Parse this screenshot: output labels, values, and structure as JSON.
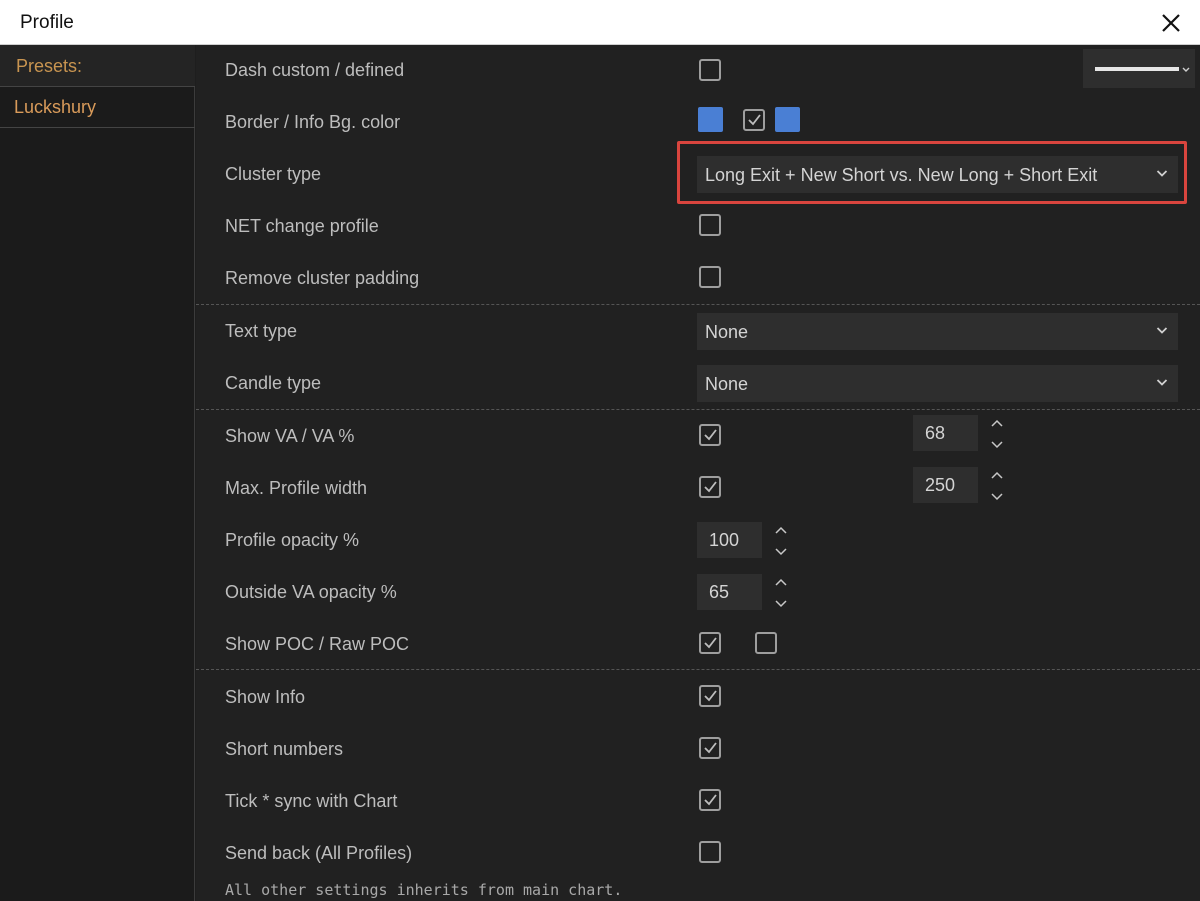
{
  "window": {
    "title": "Profile"
  },
  "sidebar": {
    "presets_label": "Presets:",
    "items": [
      {
        "label": "Luckshury"
      }
    ]
  },
  "settings": {
    "dash_custom": {
      "label": "Dash custom / defined",
      "checked": false
    },
    "border_info_bg": {
      "label": "Border / Info Bg. color",
      "border_color": "#4a7fd4",
      "info_bg_enabled": true,
      "info_bg_color": "#4a7fd4"
    },
    "cluster_type": {
      "label": "Cluster type",
      "value": "Long Exit + New Short vs. New Long + Short Exit"
    },
    "net_change": {
      "label": "NET change profile",
      "checked": false
    },
    "remove_padding": {
      "label": "Remove cluster padding",
      "checked": false
    },
    "text_type": {
      "label": "Text type",
      "value": "None"
    },
    "candle_type": {
      "label": "Candle type",
      "value": "None"
    },
    "show_va": {
      "label": "Show VA / VA %",
      "checked": true,
      "value": "68"
    },
    "max_width": {
      "label": "Max. Profile width",
      "checked": true,
      "value": "250"
    },
    "profile_opacity": {
      "label": "Profile opacity %",
      "value": "100"
    },
    "outside_va_opacity": {
      "label": "Outside VA opacity %",
      "value": "65"
    },
    "show_poc": {
      "label": "Show POC / Raw POC",
      "poc_checked": true,
      "raw_poc_checked": false
    },
    "show_info": {
      "label": "Show Info",
      "checked": true
    },
    "short_numbers": {
      "label": "Short numbers",
      "checked": true
    },
    "tick_sync": {
      "label": "Tick * sync with Chart",
      "checked": true
    },
    "send_back": {
      "label": "Send back (All Profiles)",
      "checked": false
    }
  },
  "footer": {
    "note": "All other settings inherits from main chart."
  },
  "colors": {
    "accent_highlight": "#d9453e",
    "preset_text": "#d99b5a"
  }
}
